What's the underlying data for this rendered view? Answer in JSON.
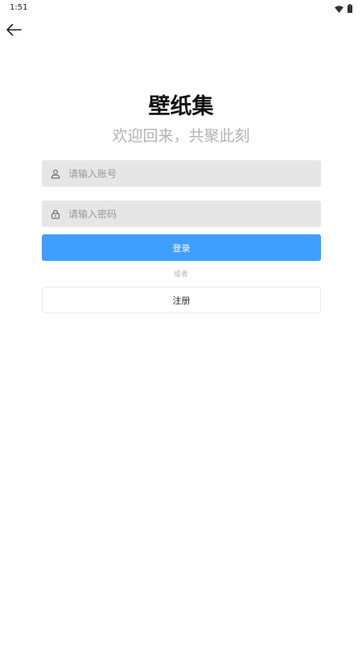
{
  "status_bar": {
    "time": "1:51",
    "icons": [
      "wifi-icon",
      "battery-icon"
    ]
  },
  "nav": {
    "back_icon": "arrow-left-icon"
  },
  "header": {
    "title": "壁纸集",
    "subtitle": "欢迎回来，共聚此刻"
  },
  "form": {
    "account": {
      "icon": "user-icon",
      "placeholder": "请输入账号",
      "value": ""
    },
    "password": {
      "icon": "lock-icon",
      "placeholder": "请输入密码",
      "value": ""
    },
    "login_label": "登录",
    "or_label": "或者",
    "register_label": "注册"
  },
  "colors": {
    "primary": "#409eff",
    "input_bg": "#e6e6e6",
    "subtitle": "#b3b3b3",
    "background": "#ffffff"
  }
}
